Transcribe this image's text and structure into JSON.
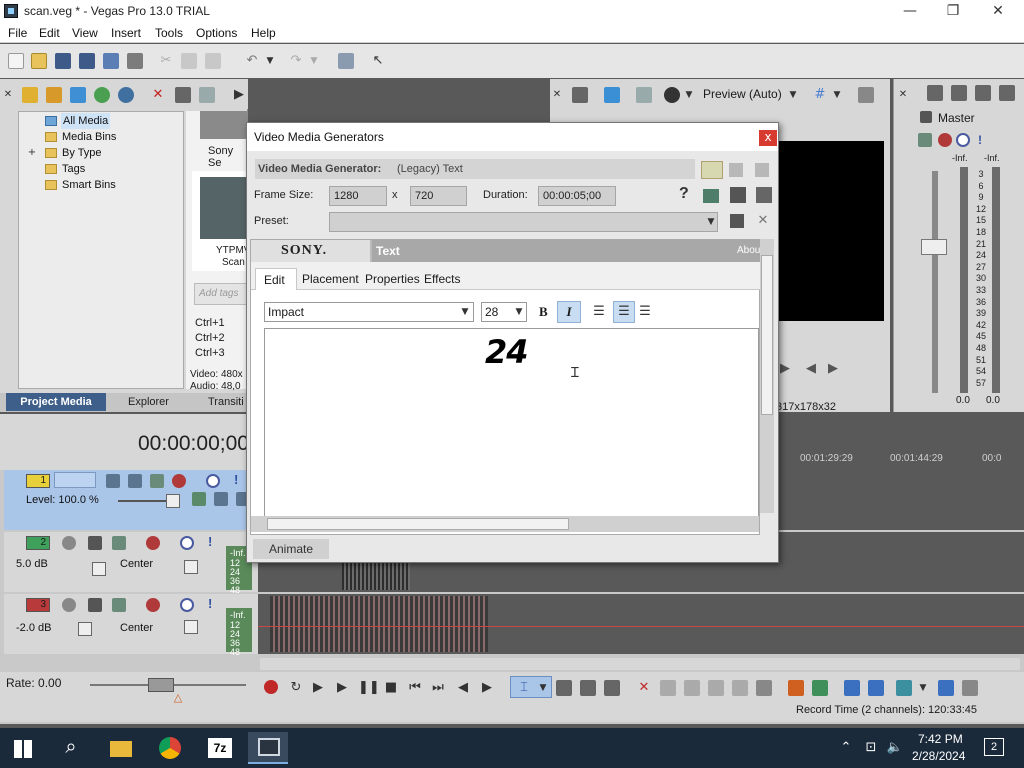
{
  "window": {
    "title": "scan.veg * - Vegas Pro 13.0 TRIAL",
    "minimize": "—",
    "maximize": "❐",
    "close": "✕"
  },
  "menu": [
    "File",
    "Edit",
    "View",
    "Insert",
    "Tools",
    "Options",
    "Help"
  ],
  "project_media": {
    "tree": [
      "All Media",
      "Media Bins",
      "By Type",
      "Tags",
      "Smart Bins"
    ],
    "expander": "+",
    "thumb_top_label": "Sony Se",
    "thumb_label_1": "YTPMV",
    "thumb_label_2": "Scan",
    "tags_placeholder": "Add tags",
    "shortcuts": [
      "Ctrl+1",
      "Ctrl+2",
      "Ctrl+3"
    ],
    "video_info": "Video: 480x",
    "audio_info": "Audio: 48,0",
    "tabs": [
      "Project Media",
      "Explorer",
      "Transiti"
    ]
  },
  "preview": {
    "mode": "Preview (Auto)",
    "resolution": "317x178x32"
  },
  "master": {
    "label": "Master",
    "inf_left": "-Inf.",
    "inf_right": "-Inf.",
    "scale": [
      "3",
      "6",
      "9",
      "12",
      "15",
      "18",
      "21",
      "24",
      "27",
      "30",
      "33",
      "36",
      "39",
      "42",
      "45",
      "48",
      "51",
      "54",
      "57"
    ],
    "bottom_left": "0.0",
    "bottom_right": "0.0"
  },
  "timeline": {
    "timecode": "00:00:00;00",
    "ruler": [
      "00:01:29:29",
      "00:01:44:29",
      "00:0"
    ],
    "rate": "Rate: 0.00",
    "record_time": "Record Time (2 channels): 120:33:45",
    "tracks": [
      {
        "number": "1",
        "label": "Level: 100.0 %",
        "color": "#e8d03a"
      },
      {
        "number": "2",
        "label": "5.0 dB",
        "pan": "Center",
        "color": "#3ea05a",
        "inf": "-Inf.",
        "scale": [
          "12",
          "24",
          "36",
          "48"
        ]
      },
      {
        "number": "3",
        "label": "-2.0 dB",
        "pan": "Center",
        "color": "#b83a3a",
        "inf": "-Inf.",
        "scale": [
          "12",
          "24",
          "36",
          "48"
        ]
      }
    ]
  },
  "dialog": {
    "title": "Video Media Generators",
    "close": "x",
    "generator_label": "Video Media Generator:",
    "generator_value": "(Legacy) Text",
    "frame_size_label": "Frame Size:",
    "width": "1280",
    "x": "x",
    "height": "720",
    "duration_label": "Duration:",
    "duration": "00:00:05;00",
    "help": "?",
    "preset_label": "Preset:",
    "preset_value": "",
    "brand": "SONY.",
    "plugin_name": "Text",
    "about": "Abou",
    "tabs": [
      "Edit",
      "Placement",
      "Properties",
      "Effects"
    ],
    "font": "Impact",
    "size": "28",
    "bold": "B",
    "italic": "I",
    "text_content": "24",
    "animate": "Animate"
  },
  "taskbar": {
    "time": "7:42 PM",
    "date": "2/28/2024",
    "notification_count": "2",
    "app_7z": "7z"
  }
}
